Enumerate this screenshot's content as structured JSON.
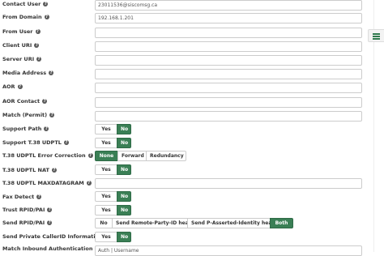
{
  "fields": {
    "contact_user": {
      "label": "Contact User",
      "value": "23011536@siscomsg.ca"
    },
    "from_domain": {
      "label": "From Domain",
      "value": "192.168.1.201"
    },
    "from_user": {
      "label": "From User",
      "value": ""
    },
    "client_uri": {
      "label": "Client URI",
      "value": ""
    },
    "server_uri": {
      "label": "Server URI",
      "value": ""
    },
    "media_address": {
      "label": "Media Address",
      "value": ""
    },
    "aor": {
      "label": "AOR",
      "value": ""
    },
    "aor_contact": {
      "label": "AOR Contact",
      "value": ""
    },
    "match_permit": {
      "label": "Match (Permit)",
      "value": ""
    },
    "t38_udptl_maxdatagram": {
      "label": "T.38 UDPTL MAXDATAGRAM",
      "value": ""
    },
    "match_inbound_auth": {
      "label": "Match Inbound Authentication",
      "value": "Auth | Username"
    }
  },
  "toggles": {
    "support_path": {
      "label": "Support Path",
      "yes": "Yes",
      "no": "No",
      "selected": "No"
    },
    "support_t38_udptl": {
      "label": "Support T.38 UDPTL",
      "yes": "Yes",
      "no": "No",
      "selected": "No"
    },
    "t38_udptl_nat": {
      "label": "T.38 UDPTL NAT",
      "yes": "Yes",
      "no": "No",
      "selected": "No"
    },
    "fax_detect": {
      "label": "Fax Detect",
      "yes": "Yes",
      "no": "No",
      "selected": "No"
    },
    "trust_rpid_pai": {
      "label": "Trust RPID/PAI",
      "yes": "Yes",
      "no": "No",
      "selected": "No"
    },
    "send_private_callerid": {
      "label": "Send Private CallerID Information",
      "yes": "Yes",
      "no": "No",
      "selected": "No"
    }
  },
  "error_correction": {
    "label": "T.38 UDPTL Error Correction",
    "options": [
      "None",
      "Forward",
      "Redundancy"
    ],
    "selected": "None"
  },
  "send_rpid_pai": {
    "label": "Send RPID/PAI",
    "options": [
      "No",
      "Send Remote-Party-ID header",
      "Send P-Asserted-Identity header",
      "Both"
    ],
    "selected": "Both"
  },
  "help_glyph": "?",
  "colors": {
    "active": "#3a7f55",
    "accent_icon": "#2f7a4d"
  }
}
